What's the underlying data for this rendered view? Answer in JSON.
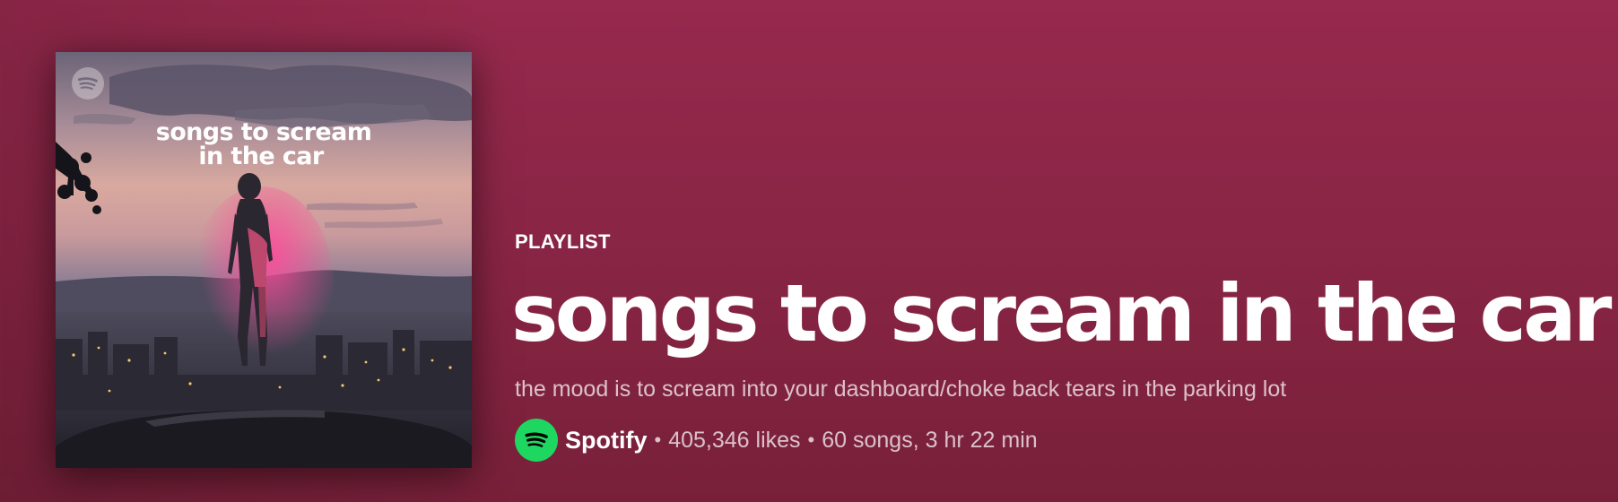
{
  "playlist": {
    "type_label": "PLAYLIST",
    "title": "songs to scream in the car",
    "description": "the mood is to scream into your dashboard/choke back tears in the parking lot",
    "cover": {
      "line1": "songs to scream",
      "line2": "in the car",
      "logo_icon": "spotify-logo-icon"
    },
    "owner": {
      "name": "Spotify",
      "avatar_icon": "spotify-logo-icon",
      "avatar_color": "#1ed760"
    },
    "separator": "•",
    "likes": "405,346 likes",
    "summary": "60 songs, 3 hr 22 min"
  },
  "colors": {
    "background": "#8a2546",
    "text": "#ffffff",
    "brand": "#1ed760"
  }
}
